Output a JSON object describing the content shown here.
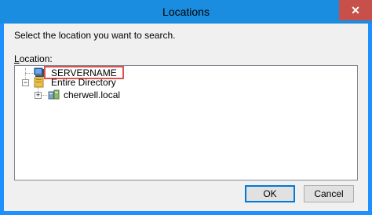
{
  "window": {
    "title": "Locations",
    "close_glyph": "✕"
  },
  "prompt": "Select the location you want to search.",
  "location_label": {
    "mnemonic": "L",
    "rest": "ocation:"
  },
  "tree": {
    "items": [
      {
        "label": "SERVERNAME",
        "icon": "computer-icon",
        "selected": true
      },
      {
        "label": "Entire Directory",
        "icon": "directory-book-icon",
        "expander": "−"
      },
      {
        "label": "cherwell.local",
        "icon": "domain-icon",
        "expander": "+"
      }
    ]
  },
  "buttons": {
    "ok": "OK",
    "cancel": "Cancel"
  },
  "colors": {
    "titlebar": "#1a8de0",
    "highlight_border": "#d9534f",
    "default_button_border": "#0078d7"
  }
}
